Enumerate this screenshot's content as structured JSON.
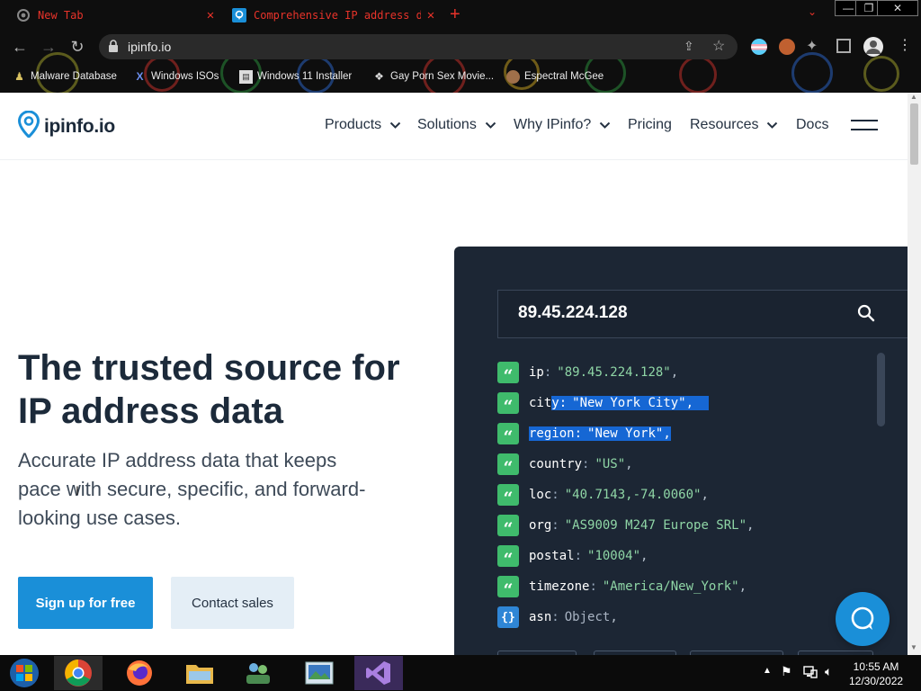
{
  "browser": {
    "tabs": [
      {
        "title": "New Tab",
        "active": false
      },
      {
        "title": "Comprehensive IP address data, IP",
        "active": true
      }
    ],
    "address": "ipinfo.io",
    "bookmarks": [
      {
        "label": "Malware Database",
        "icon": "person-icon"
      },
      {
        "label": "Windows ISOs",
        "icon": "x-icon"
      },
      {
        "label": "Windows 11 Installer",
        "icon": "page-icon"
      },
      {
        "label": "Gay Porn Sex Movie...",
        "icon": "site-icon"
      },
      {
        "label": "Espectral McGee",
        "icon": "avatar-icon"
      }
    ],
    "window_controls": [
      "—",
      "❐",
      "✕"
    ]
  },
  "site": {
    "logo_text": "ipinfo.io",
    "nav": [
      {
        "label": "Products",
        "dropdown": true
      },
      {
        "label": "Solutions",
        "dropdown": true
      },
      {
        "label": "Why IPinfo?",
        "dropdown": true
      },
      {
        "label": "Pricing",
        "dropdown": false
      },
      {
        "label": "Resources",
        "dropdown": true
      },
      {
        "label": "Docs",
        "dropdown": false
      }
    ],
    "hero": {
      "title": "The trusted source for IP address data",
      "subtitle": "Accurate IP address data that keeps pace with secure, specific, and forward-looking use cases.",
      "primary_cta": "Sign up for free",
      "secondary_cta": "Contact sales"
    },
    "lookup": {
      "ip": "89.45.224.128",
      "fields": [
        {
          "key": "ip",
          "value": "\"89.45.224.128\"",
          "type": "string",
          "highlight": "none"
        },
        {
          "key": "city",
          "value": "\"New York City\"",
          "type": "string",
          "highlight": "partial"
        },
        {
          "key": "region",
          "value": "\"New York\"",
          "type": "string",
          "highlight": "full"
        },
        {
          "key": "country",
          "value": "\"US\"",
          "type": "string",
          "highlight": "none"
        },
        {
          "key": "loc",
          "value": "\"40.7143,-74.0060\"",
          "type": "string",
          "highlight": "none"
        },
        {
          "key": "org",
          "value": "\"AS9009 M247 Europe SRL\"",
          "type": "string",
          "highlight": "none"
        },
        {
          "key": "postal",
          "value": "\"10004\"",
          "type": "string",
          "highlight": "none"
        },
        {
          "key": "timezone",
          "value": "\"America/New_York\"",
          "type": "string",
          "highlight": "none"
        },
        {
          "key": "asn",
          "value": "Object",
          "type": "object",
          "highlight": "none"
        }
      ]
    }
  },
  "taskbar": {
    "apps": [
      "start-orb",
      "chrome",
      "firefox",
      "file-explorer",
      "network-app",
      "image-viewer",
      "visual-studio"
    ],
    "time": "10:55 AM",
    "date": "12/30/2022"
  },
  "colors": {
    "brand": "#1a8fd8",
    "panel": "#1c2634",
    "string_value": "#8fd6a6",
    "quote_badge": "#3fbb6c",
    "object_badge": "#2f86d6",
    "selection": "#1667d4",
    "tab_text": "#e8332a"
  }
}
